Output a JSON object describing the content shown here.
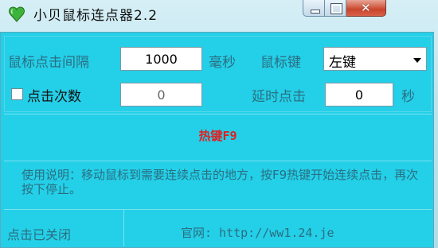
{
  "window": {
    "title": "小贝鼠标连点器2.2",
    "close_glyph": "✕"
  },
  "settings": {
    "interval_label": "鼠标点击间隔",
    "interval_value": "1000",
    "interval_unit": "毫秒",
    "mouse_button_label": "鼠标键",
    "mouse_button_value": "左键",
    "click_count_checkbox_label": "点击次数",
    "click_count_checked": false,
    "click_count_value": "0",
    "delay_label": "延时点击",
    "delay_value": "0",
    "delay_unit": "秒"
  },
  "hotkey": {
    "text": "热键F9"
  },
  "info": {
    "text": "使用说明：移动鼠标到需要连续点击的地方，按F9热键开始连续点击，再次按下停止。"
  },
  "status": {
    "state": "点击已关闭",
    "website": "官网: http://ww1.24.je"
  },
  "colors": {
    "client_bg": "#24cfe8",
    "label_text": "#2a6f80",
    "hotkey_text": "#e02020",
    "close_button": "#c9452c"
  },
  "icons": {
    "app": "green-heart-icon",
    "minimize": "minimize-icon",
    "maximize": "maximize-icon",
    "close": "close-icon",
    "dropdown": "chevron-down-icon"
  }
}
